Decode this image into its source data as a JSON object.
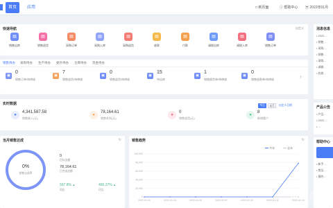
{
  "topbar": {
    "tabs": [
      {
        "label": "首页"
      },
      {
        "label": "应用"
      }
    ],
    "links": [
      "□ 新页面",
      "ⓘ 帮助中心",
      "▣ 2022年01月"
    ]
  },
  "quick": {
    "title": "快速导航",
    "action": "自定义",
    "items": [
      {
        "label": "销售出库",
        "color": "#6f8cf7",
        "icon": "order-icon"
      },
      {
        "label": "销售退货",
        "color": "#f36fa6",
        "icon": "return-icon"
      },
      {
        "label": "采购订单",
        "color": "#f58b65",
        "icon": "purchase-icon"
      },
      {
        "label": "采购入库",
        "color": "#8fa4f8",
        "icon": "stock-in-icon"
      },
      {
        "label": "采购退货",
        "color": "#f37b72",
        "icon": "refund-icon"
      },
      {
        "label": "收款",
        "color": "#f6b84b",
        "icon": "receipt-icon"
      },
      {
        "label": "付款",
        "color": "#f3a14d",
        "icon": "pay-icon"
      },
      {
        "label": "调拨出库",
        "color": "#6e9bf5",
        "icon": "transfer-icon"
      },
      {
        "label": "调拨入库",
        "color": "#f36f7f",
        "icon": "transfer-in-icon"
      },
      {
        "label": "销售订单",
        "color": "#7d8ef5",
        "icon": "sale-order-icon"
      }
    ]
  },
  "todo": {
    "tabs": [
      "销售待办",
      "采购待办",
      "生产待办",
      "委外待办",
      "仓库待办",
      "资金待办"
    ],
    "items": [
      {
        "num": "0",
        "desc": "销售订单/待审核",
        "color": "#7d95f7"
      },
      {
        "num": "7",
        "desc": "销售退货/待审核",
        "color": "#f5a25d"
      },
      {
        "num": "0",
        "desc": "销售退货/待审核",
        "color": "#6f8cf7"
      },
      {
        "num": "15",
        "desc": "待出库",
        "color": "#6f8cf7"
      },
      {
        "num": "1",
        "desc": "销售换货单/待审核",
        "color": "#6f8cf7"
      },
      {
        "num": "0",
        "desc": "销售退款单/待审核",
        "color": "#6f8cf7"
      }
    ]
  },
  "realtime": {
    "title": "实时数据",
    "ranges": [
      "今日",
      "本月",
      "自定义日期"
    ],
    "items": [
      {
        "num": "4,341,587.58",
        "desc": "销售收入(元)",
        "color": "#4a7cf6",
        "bg": "#e8eefe"
      },
      {
        "num": "78,164.61",
        "desc": "销售毛利(元)",
        "color": "#f5a25d",
        "bg": "#fdf1e4"
      },
      {
        "num": "0",
        "desc": "销售退货(元)",
        "color": "#f36f7f",
        "bg": "#fde8ec"
      },
      {
        "num": "8",
        "desc": "新增客户",
        "color": "#5cbf8f",
        "bg": "#e4f6ee"
      }
    ]
  },
  "target": {
    "title": "当月销售达成",
    "percent": "0%",
    "ring_label": "销售达成率",
    "rows": [
      {
        "num": "0",
        "desc": "目标金额"
      },
      {
        "num": "78,164.61",
        "desc": "已完成金额"
      }
    ],
    "stats": [
      {
        "num": "597.8%",
        "desc": "同比"
      },
      {
        "num": "465.37%",
        "desc": "环比"
      }
    ]
  },
  "trend": {
    "title": "销售趋势",
    "legend": [
      "今年",
      "去年"
    ]
  },
  "right": {
    "msg_title": "消息信息",
    "msgs": [
      "• 2022...",
      "• 销售...",
      "• 采购...",
      "• 销售...",
      "• 采购...",
      "• 调拨...",
      "• 应收..."
    ],
    "product_title": "产品公告",
    "product_items": [
      "• 产品...",
      "• 2022...",
      "• ..."
    ],
    "help_title": "帮助中心",
    "help_items": [
      "• 新手...",
      "• 常见...",
      "• 操作..."
    ]
  },
  "watermark": "知乎 @",
  "chart_data": {
    "type": "line",
    "title": "销售趋势",
    "x": [
      "2022-01-01",
      "2022-01-03",
      "2022-01-05",
      "2022-01-07",
      "2022-01-09",
      "2022-01-11",
      "2022-01-13"
    ],
    "ylim": [
      0,
      100000
    ],
    "y_ticks": [
      "100,000",
      "80,000",
      "60,000",
      "40,000",
      "20,000",
      "0"
    ],
    "series": [
      {
        "name": "今年",
        "values": [
          0,
          0,
          0,
          0,
          0,
          0,
          78164.61
        ],
        "color": "#4a7cf6"
      },
      {
        "name": "去年",
        "values": [
          0,
          0,
          0,
          0,
          0,
          0,
          0
        ],
        "color": "#c4cad6"
      }
    ],
    "grid": true,
    "legend": "top-right"
  }
}
